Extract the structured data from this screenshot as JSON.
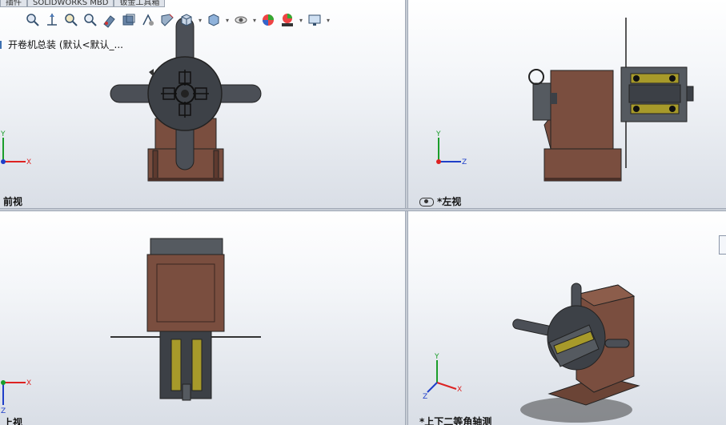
{
  "tabs": [
    "插件",
    "SOLIDWORKS MBD",
    "钣金工具箱"
  ],
  "tree_root": "开卷机总装  (默认<默认_...",
  "toolbar_icons": [
    "zoom-to-fit-icon",
    "zoom-area-icon",
    "previous-view-icon",
    "section-view-icon",
    "view-selector-icon",
    "display-style-icon",
    "hide-show-icon",
    "edit-appearance-icon",
    "apply-scene-icon",
    "view-settings-icon"
  ],
  "views": {
    "front": {
      "label": "前视"
    },
    "left": {
      "label": "*左视"
    },
    "top": {
      "label": "上视"
    },
    "iso": {
      "label": "*上下二等角轴测"
    }
  },
  "axes": {
    "x": "X",
    "y": "Y",
    "z": "Z"
  },
  "colors": {
    "body": "#7a4e3f",
    "frame": "#3a3d42",
    "accent": "#a79a2a"
  }
}
